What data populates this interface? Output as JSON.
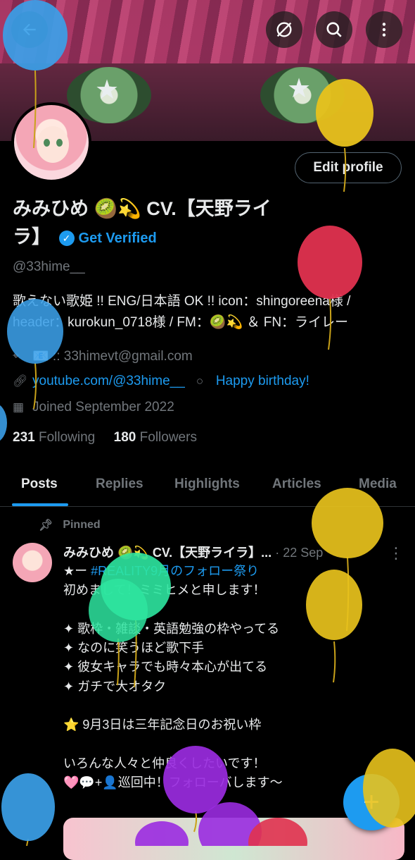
{
  "header": {
    "back_icon": "arrow-left-icon",
    "translate_icon": "slash-circle-icon",
    "search_icon": "search-icon",
    "more_icon": "vertical-dots-icon"
  },
  "profile": {
    "edit_label": "Edit profile",
    "name_line": "みみひめ 🥝💫 CV.【天野ライラ】",
    "verify_label": "Get Verified",
    "handle": "@33hime__",
    "bio": "歌えない歌姫 !! ENG/日本語 OK !! icon：shingoreena様 / header：kurokun_0718様 / FM：🥝💫 ＆ FN：ライレー",
    "location": "📧 :: 33himevt@gmail.com",
    "website": "youtube.com/@33hime__",
    "birthday": "Happy birthday!",
    "joined": "Joined September 2022",
    "following_count": "231",
    "following_label": "Following",
    "followers_count": "180",
    "followers_label": "Followers"
  },
  "tabs": [
    "Posts",
    "Replies",
    "Highlights",
    "Articles",
    "Media"
  ],
  "pinned_post": {
    "pinned_label": "Pinned",
    "author": "みみひめ 🥝💫 CV.【天野ライラ】...",
    "date": "· 22 Sep",
    "hashtag": "#REALITY9月のフォロー祭り",
    "lead": "★ー ",
    "body": "初めまして！ミミヒメと申します！\n\n✦ 歌枠・雑談・英語勉強の枠やってる\n✦ なのに笑うほど歌下手\n✦ 彼女キャラでも時々本心が出てる\n✦ ガチで大オタク\n\n⭐ 9月3日は三年記念日のお祝い枠\n\nいろんな人々と仲良くしたいです！\n🩷💬+👤巡回中！フォローバします〜"
  },
  "colors": {
    "accent": "#1d9bf0",
    "background": "#000000",
    "muted": "#71767b",
    "balloon_blue": "#3b9fe8",
    "balloon_yellow": "#e8c21c",
    "balloon_red": "#e0324f",
    "balloon_green": "#2ee5a0",
    "balloon_purple": "#9a2be0"
  }
}
